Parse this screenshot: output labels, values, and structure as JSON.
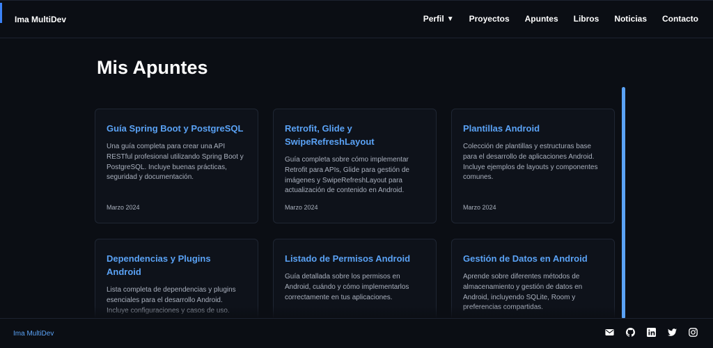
{
  "header": {
    "brand": "Ima MultiDev",
    "nav": [
      {
        "label": "Perfil",
        "icon": "chevron-down-icon"
      },
      {
        "label": "Proyectos"
      },
      {
        "label": "Apuntes"
      },
      {
        "label": "Libros"
      },
      {
        "label": "Noticias"
      },
      {
        "label": "Contacto"
      }
    ],
    "caret": "▼"
  },
  "main": {
    "title": "Mis Apuntes",
    "cards": [
      {
        "title": "Guía Spring Boot y PostgreSQL",
        "description": "Una guía completa para crear una API RESTful profesional utilizando Spring Boot y PostgreSQL. Incluye buenas prácticas, seguridad y documentación.",
        "date": "Marzo 2024"
      },
      {
        "title": "Retrofit, Glide y SwipeRefreshLayout",
        "description": "Guía completa sobre cómo implementar Retrofit para APIs, Glide para gestión de imágenes y SwipeRefreshLayout para actualización de contenido en Android.",
        "date": "Marzo 2024"
      },
      {
        "title": "Plantillas Android",
        "description": "Colección de plantillas y estructuras base para el desarrollo de aplicaciones Android. Incluye ejemplos de layouts y componentes comunes.",
        "date": "Marzo 2024"
      },
      {
        "title": "Dependencias y Plugins Android",
        "description": "Lista completa de dependencias y plugins esenciales para el desarrollo Android. Incluye configuraciones y casos de uso.",
        "date": ""
      },
      {
        "title": "Listado de Permisos Android",
        "description": "Guía detallada sobre los permisos en Android, cuándo y cómo implementarlos correctamente en tus aplicaciones.",
        "date": ""
      },
      {
        "title": "Gestión de Datos en Android",
        "description": "Aprende sobre diferentes métodos de almacenamiento y gestión de datos en Android, incluyendo SQLite, Room y preferencias compartidas.",
        "date": ""
      }
    ]
  },
  "footer": {
    "brand": "Ima MultiDev",
    "social": [
      "email-icon",
      "github-icon",
      "linkedin-icon",
      "twitter-icon",
      "instagram-icon"
    ]
  },
  "colors": {
    "background": "#0b0e14",
    "accent": "#3b82f6",
    "card_title": "#5aa2f5",
    "text_muted": "#aab1be"
  }
}
